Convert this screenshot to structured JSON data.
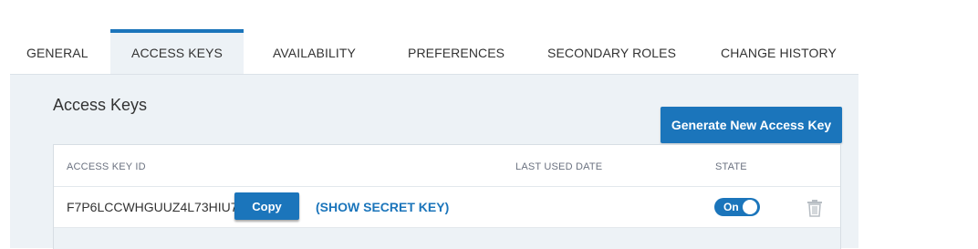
{
  "tabs": [
    {
      "label": "GENERAL"
    },
    {
      "label": "ACCESS KEYS"
    },
    {
      "label": "AVAILABILITY"
    },
    {
      "label": "PREFERENCES"
    },
    {
      "label": "SECONDARY ROLES"
    },
    {
      "label": "CHANGE HISTORY"
    }
  ],
  "active_tab": "ACCESS KEYS",
  "panel": {
    "title": "Access Keys",
    "generate_button": "Generate New Access Key"
  },
  "table": {
    "columns": {
      "key_id": "ACCESS KEY ID",
      "last_used": "LAST USED DATE",
      "state": "STATE"
    },
    "rows": [
      {
        "key_id": "F7P6LCCWHGUUZ4L73HIU74",
        "copy_label": "Copy",
        "show_secret": "(SHOW SECRET KEY)",
        "last_used": "",
        "state_label": "On"
      }
    ]
  },
  "colors": {
    "accent": "#1b75bb",
    "panel_bg": "#edf2f6"
  },
  "icons": [
    "trash-icon"
  ]
}
